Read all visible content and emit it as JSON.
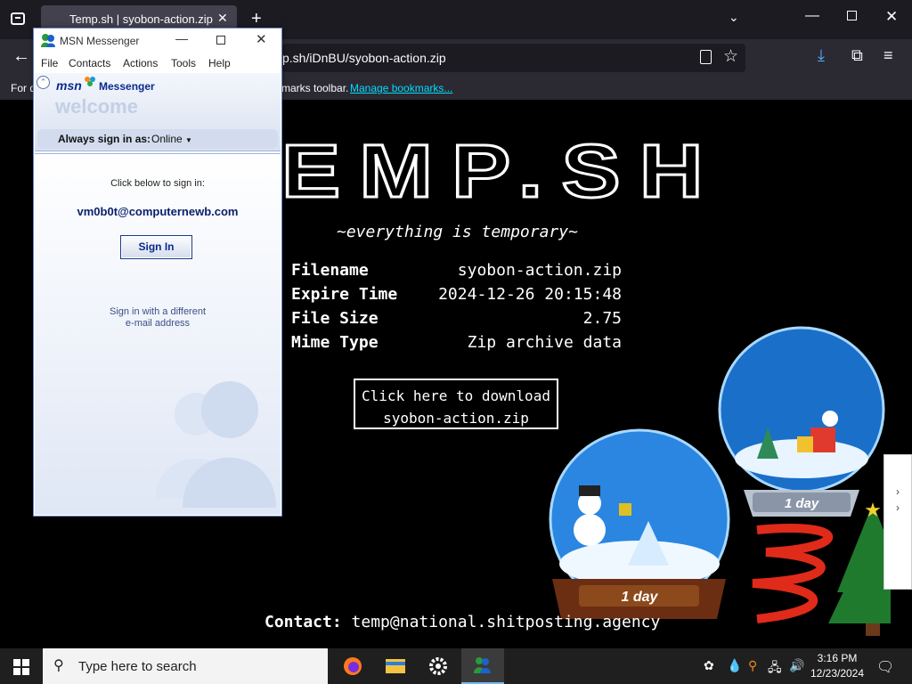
{
  "browser": {
    "tab_title": "Temp.sh | syobon-action.zip",
    "new_tab_symbol": "+",
    "url": "p.sh/iDnBU/syobon-action.zip",
    "bookmarks_left": "For q",
    "bookmarks_text": "marks toolbar.",
    "bookmarks_link": "Manage bookmarks..."
  },
  "page": {
    "site_title": "EMP.SH",
    "tagline": "~everything is temporary~",
    "info": [
      {
        "label": "Filename",
        "value": "syobon-action.zip"
      },
      {
        "label": "Expire Time",
        "value": "2024-12-26 20:15:48"
      },
      {
        "label": "File Size",
        "value": "2.75"
      },
      {
        "label": "Mime Type",
        "value": "Zip archive data"
      }
    ],
    "download_line1": "Click here to download",
    "download_line2": "syobon-action.zip",
    "contact_label": "Contact:",
    "contact_value": "temp@national.shitposting.agency",
    "globe_label_1": "1 day",
    "globe_label_2": "1 day"
  },
  "msn": {
    "title": "MSN Messenger",
    "menu": [
      "File",
      "Contacts",
      "Actions",
      "Tools",
      "Help"
    ],
    "brand": "msn",
    "brand_word": "Messenger",
    "welcome": "welcome",
    "always_label": "Always sign in as:",
    "status": "Online",
    "prompt": "Click below to sign in:",
    "email": "vm0b0t@computernewb.com",
    "signin_label": "Sign In",
    "different_line1": "Sign in with a different",
    "different_line2": "e-mail address"
  },
  "taskbar": {
    "search_placeholder": "Type here to search",
    "time": "3:16 PM",
    "date": "12/23/2024"
  },
  "colors": {
    "link": "#00ddff",
    "download_accent": "#4fb3ff",
    "msn_blue": "#0a2b8c"
  }
}
